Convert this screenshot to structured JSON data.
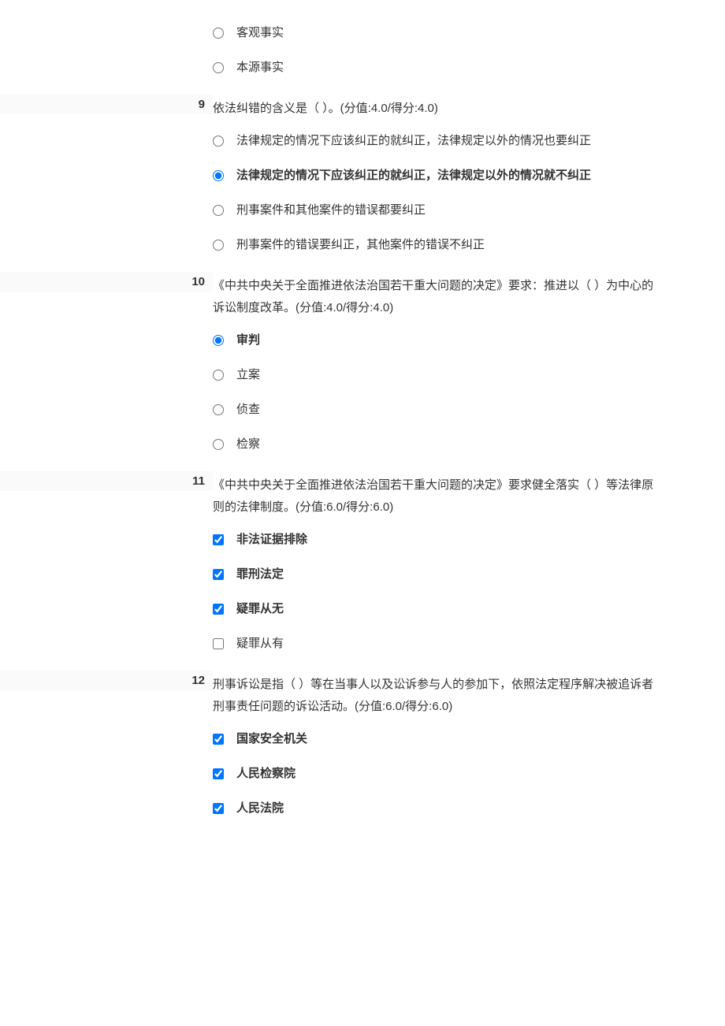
{
  "questions": [
    {
      "num": "",
      "text": "",
      "type": "radio",
      "options": [
        {
          "label": "客观事实",
          "checked": false,
          "bold": false
        },
        {
          "label": "本源事实",
          "checked": false,
          "bold": false
        }
      ]
    },
    {
      "num": "9",
      "text": "依法纠错的含义是（ ）。(分值:4.0/得分:4.0)",
      "type": "radio",
      "options": [
        {
          "label": "法律规定的情况下应该纠正的就纠正，法律规定以外的情况也要纠正",
          "checked": false,
          "bold": false
        },
        {
          "label": "法律规定的情况下应该纠正的就纠正，法律规定以外的情况就不纠正",
          "checked": true,
          "bold": true
        },
        {
          "label": "刑事案件和其他案件的错误都要纠正",
          "checked": false,
          "bold": false
        },
        {
          "label": "刑事案件的错误要纠正，其他案件的错误不纠正",
          "checked": false,
          "bold": false
        }
      ]
    },
    {
      "num": "10",
      "text": "《中共中央关于全面推进依法治国若干重大问题的决定》要求：推进以（ ）为中心的诉讼制度改革。(分值:4.0/得分:4.0)",
      "type": "radio",
      "options": [
        {
          "label": "审判",
          "checked": true,
          "bold": true
        },
        {
          "label": "立案",
          "checked": false,
          "bold": false
        },
        {
          "label": "侦查",
          "checked": false,
          "bold": false
        },
        {
          "label": "检察",
          "checked": false,
          "bold": false
        }
      ]
    },
    {
      "num": "11",
      "text": "《中共中央关于全面推进依法治国若干重大问题的决定》要求健全落实（ ）等法律原则的法律制度。(分值:6.0/得分:6.0)",
      "type": "checkbox",
      "options": [
        {
          "label": "非法证据排除",
          "checked": true,
          "bold": true
        },
        {
          "label": "罪刑法定",
          "checked": true,
          "bold": true
        },
        {
          "label": "疑罪从无",
          "checked": true,
          "bold": true
        },
        {
          "label": "疑罪从有",
          "checked": false,
          "bold": false
        }
      ]
    },
    {
      "num": "12",
      "text": "刑事诉讼是指（ ）等在当事人以及讼诉参与人的参加下，依照法定程序解决被追诉者刑事责任问题的诉讼活动。(分值:6.0/得分:6.0)",
      "type": "checkbox",
      "options": [
        {
          "label": "国家安全机关",
          "checked": true,
          "bold": true
        },
        {
          "label": "人民检察院",
          "checked": true,
          "bold": true
        },
        {
          "label": "人民法院",
          "checked": true,
          "bold": true
        }
      ]
    }
  ]
}
